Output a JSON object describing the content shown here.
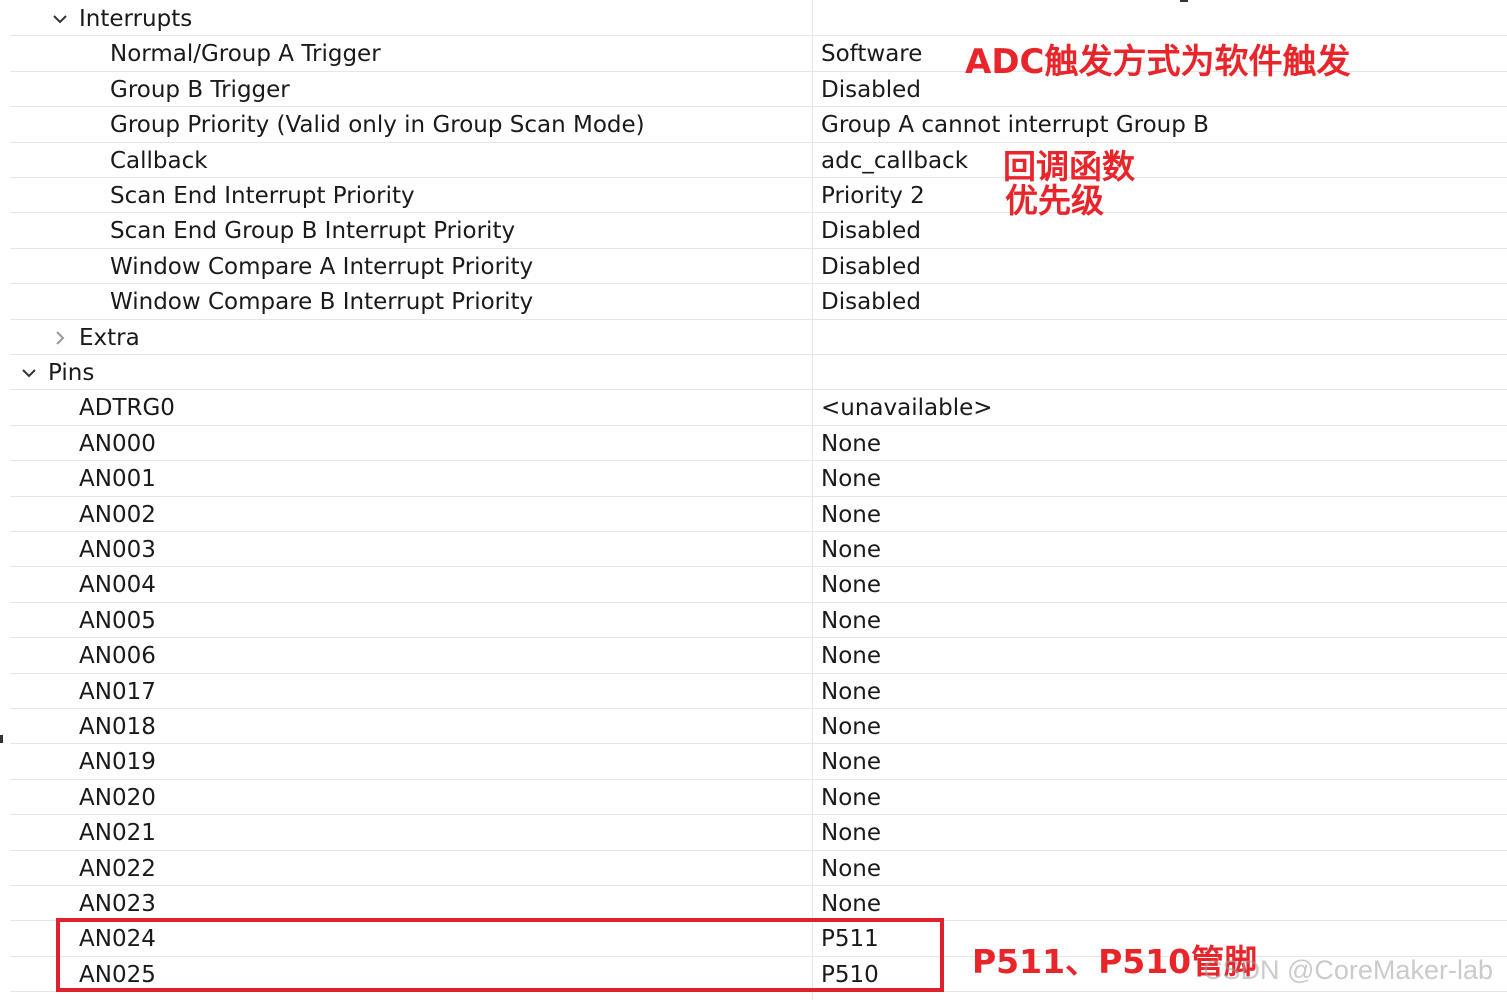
{
  "sections": {
    "interrupts": {
      "label": "Interrupts",
      "rows": [
        {
          "name": "Normal/Group A Trigger",
          "value": "Software"
        },
        {
          "name": "Group B Trigger",
          "value": "Disabled"
        },
        {
          "name": "Group Priority (Valid only in Group Scan Mode)",
          "value": "Group A cannot interrupt Group B"
        },
        {
          "name": "Callback",
          "value": "adc_callback"
        },
        {
          "name": "Scan End Interrupt Priority",
          "value": "Priority 2"
        },
        {
          "name": "Scan End Group B Interrupt Priority",
          "value": "Disabled"
        },
        {
          "name": "Window Compare A Interrupt Priority",
          "value": "Disabled"
        },
        {
          "name": "Window Compare B Interrupt Priority",
          "value": "Disabled"
        }
      ]
    },
    "extra": {
      "label": "Extra"
    },
    "pins": {
      "label": "Pins",
      "rows": [
        {
          "name": "ADTRG0",
          "value": "<unavailable>"
        },
        {
          "name": "AN000",
          "value": "None"
        },
        {
          "name": "AN001",
          "value": "None"
        },
        {
          "name": "AN002",
          "value": "None"
        },
        {
          "name": "AN003",
          "value": "None"
        },
        {
          "name": "AN004",
          "value": "None"
        },
        {
          "name": "AN005",
          "value": "None"
        },
        {
          "name": "AN006",
          "value": "None"
        },
        {
          "name": "AN017",
          "value": "None"
        },
        {
          "name": "AN018",
          "value": "None"
        },
        {
          "name": "AN019",
          "value": "None"
        },
        {
          "name": "AN020",
          "value": "None"
        },
        {
          "name": "AN021",
          "value": "None"
        },
        {
          "name": "AN022",
          "value": "None"
        },
        {
          "name": "AN023",
          "value": "None"
        },
        {
          "name": "AN024",
          "value": "P511"
        },
        {
          "name": "AN025",
          "value": "P510"
        }
      ]
    }
  },
  "annotations": {
    "trigger_note": "ADC触发方式为软件触发",
    "callback_note": "回调函数",
    "priority_note": "优先级",
    "pins_note": "P511、P510管脚"
  },
  "watermark": "CSDN @CoreMaker-lab",
  "colors": {
    "annotation": "#e8252b",
    "grid_line": "#e6e6e6"
  }
}
